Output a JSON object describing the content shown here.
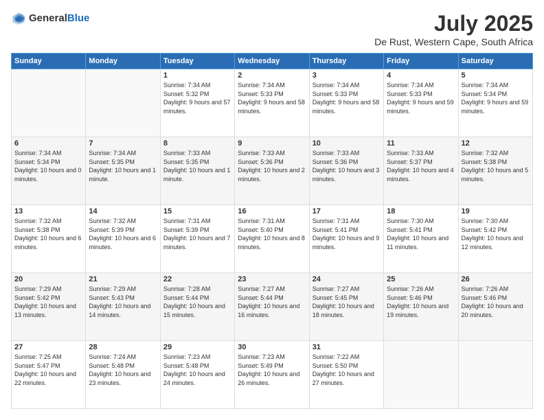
{
  "header": {
    "logo_general": "General",
    "logo_blue": "Blue",
    "title": "July 2025",
    "location": "De Rust, Western Cape, South Africa"
  },
  "columns": [
    "Sunday",
    "Monday",
    "Tuesday",
    "Wednesday",
    "Thursday",
    "Friday",
    "Saturday"
  ],
  "weeks": [
    [
      {
        "day": "",
        "info": ""
      },
      {
        "day": "",
        "info": ""
      },
      {
        "day": "1",
        "info": "Sunrise: 7:34 AM\nSunset: 5:32 PM\nDaylight: 9 hours and 57 minutes."
      },
      {
        "day": "2",
        "info": "Sunrise: 7:34 AM\nSunset: 5:33 PM\nDaylight: 9 hours and 58 minutes."
      },
      {
        "day": "3",
        "info": "Sunrise: 7:34 AM\nSunset: 5:33 PM\nDaylight: 9 hours and 58 minutes."
      },
      {
        "day": "4",
        "info": "Sunrise: 7:34 AM\nSunset: 5:33 PM\nDaylight: 9 hours and 59 minutes."
      },
      {
        "day": "5",
        "info": "Sunrise: 7:34 AM\nSunset: 5:34 PM\nDaylight: 9 hours and 59 minutes."
      }
    ],
    [
      {
        "day": "6",
        "info": "Sunrise: 7:34 AM\nSunset: 5:34 PM\nDaylight: 10 hours and 0 minutes."
      },
      {
        "day": "7",
        "info": "Sunrise: 7:34 AM\nSunset: 5:35 PM\nDaylight: 10 hours and 1 minute."
      },
      {
        "day": "8",
        "info": "Sunrise: 7:33 AM\nSunset: 5:35 PM\nDaylight: 10 hours and 1 minute."
      },
      {
        "day": "9",
        "info": "Sunrise: 7:33 AM\nSunset: 5:36 PM\nDaylight: 10 hours and 2 minutes."
      },
      {
        "day": "10",
        "info": "Sunrise: 7:33 AM\nSunset: 5:36 PM\nDaylight: 10 hours and 3 minutes."
      },
      {
        "day": "11",
        "info": "Sunrise: 7:33 AM\nSunset: 5:37 PM\nDaylight: 10 hours and 4 minutes."
      },
      {
        "day": "12",
        "info": "Sunrise: 7:32 AM\nSunset: 5:38 PM\nDaylight: 10 hours and 5 minutes."
      }
    ],
    [
      {
        "day": "13",
        "info": "Sunrise: 7:32 AM\nSunset: 5:38 PM\nDaylight: 10 hours and 6 minutes."
      },
      {
        "day": "14",
        "info": "Sunrise: 7:32 AM\nSunset: 5:39 PM\nDaylight: 10 hours and 6 minutes."
      },
      {
        "day": "15",
        "info": "Sunrise: 7:31 AM\nSunset: 5:39 PM\nDaylight: 10 hours and 7 minutes."
      },
      {
        "day": "16",
        "info": "Sunrise: 7:31 AM\nSunset: 5:40 PM\nDaylight: 10 hours and 8 minutes."
      },
      {
        "day": "17",
        "info": "Sunrise: 7:31 AM\nSunset: 5:41 PM\nDaylight: 10 hours and 9 minutes."
      },
      {
        "day": "18",
        "info": "Sunrise: 7:30 AM\nSunset: 5:41 PM\nDaylight: 10 hours and 11 minutes."
      },
      {
        "day": "19",
        "info": "Sunrise: 7:30 AM\nSunset: 5:42 PM\nDaylight: 10 hours and 12 minutes."
      }
    ],
    [
      {
        "day": "20",
        "info": "Sunrise: 7:29 AM\nSunset: 5:42 PM\nDaylight: 10 hours and 13 minutes."
      },
      {
        "day": "21",
        "info": "Sunrise: 7:29 AM\nSunset: 5:43 PM\nDaylight: 10 hours and 14 minutes."
      },
      {
        "day": "22",
        "info": "Sunrise: 7:28 AM\nSunset: 5:44 PM\nDaylight: 10 hours and 15 minutes."
      },
      {
        "day": "23",
        "info": "Sunrise: 7:27 AM\nSunset: 5:44 PM\nDaylight: 10 hours and 16 minutes."
      },
      {
        "day": "24",
        "info": "Sunrise: 7:27 AM\nSunset: 5:45 PM\nDaylight: 10 hours and 18 minutes."
      },
      {
        "day": "25",
        "info": "Sunrise: 7:26 AM\nSunset: 5:46 PM\nDaylight: 10 hours and 19 minutes."
      },
      {
        "day": "26",
        "info": "Sunrise: 7:26 AM\nSunset: 5:46 PM\nDaylight: 10 hours and 20 minutes."
      }
    ],
    [
      {
        "day": "27",
        "info": "Sunrise: 7:25 AM\nSunset: 5:47 PM\nDaylight: 10 hours and 22 minutes."
      },
      {
        "day": "28",
        "info": "Sunrise: 7:24 AM\nSunset: 5:48 PM\nDaylight: 10 hours and 23 minutes."
      },
      {
        "day": "29",
        "info": "Sunrise: 7:23 AM\nSunset: 5:48 PM\nDaylight: 10 hours and 24 minutes."
      },
      {
        "day": "30",
        "info": "Sunrise: 7:23 AM\nSunset: 5:49 PM\nDaylight: 10 hours and 26 minutes."
      },
      {
        "day": "31",
        "info": "Sunrise: 7:22 AM\nSunset: 5:50 PM\nDaylight: 10 hours and 27 minutes."
      },
      {
        "day": "",
        "info": ""
      },
      {
        "day": "",
        "info": ""
      }
    ]
  ]
}
